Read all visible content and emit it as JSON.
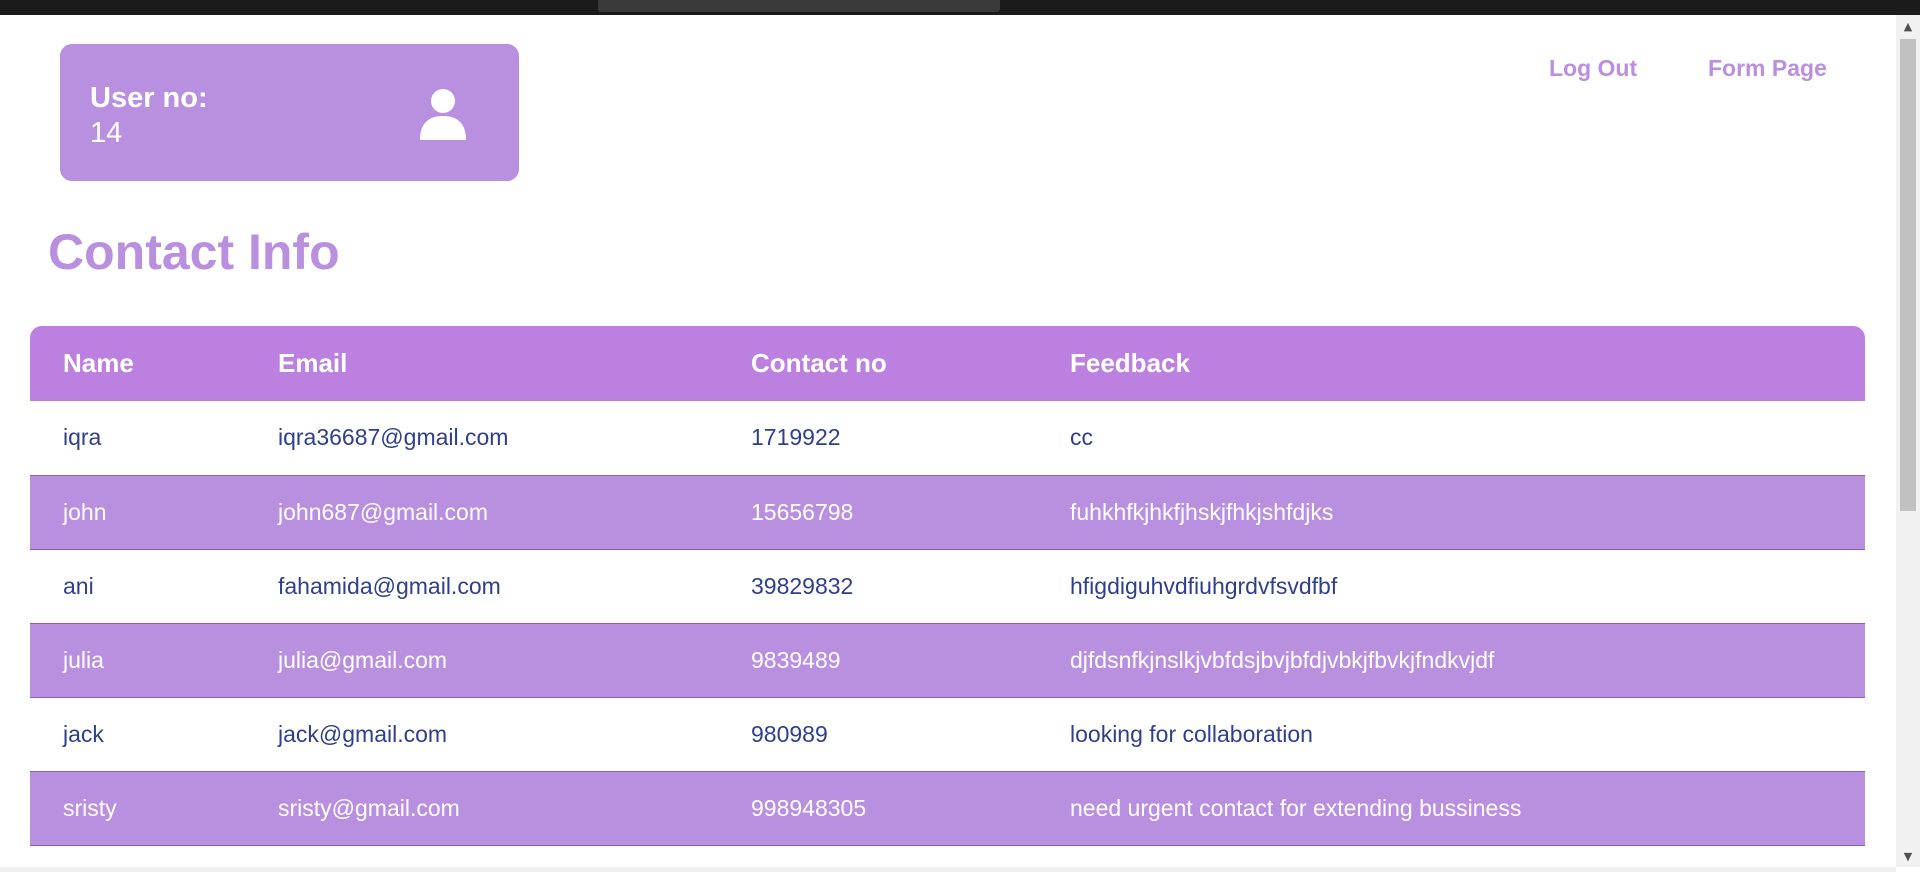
{
  "header": {
    "user_label": "User no:",
    "user_number": "14",
    "user_icon": "user-icon"
  },
  "nav": {
    "logout_label": "Log Out",
    "form_label": "Form Page"
  },
  "page": {
    "title": "Contact Info"
  },
  "table": {
    "columns": [
      "Name",
      "Email",
      "Contact no",
      "Feedback"
    ],
    "rows": [
      {
        "name": "iqra",
        "email": "iqra36687@gmail.com",
        "contact": "1719922",
        "feedback": "cc"
      },
      {
        "name": "john",
        "email": "john687@gmail.com",
        "contact": "15656798",
        "feedback": "fuhkhfkjhkfjhskjfhkjshfdjks"
      },
      {
        "name": "ani",
        "email": "fahamida@gmail.com",
        "contact": "39829832",
        "feedback": "hfigdiguhvdfiuhgrdvfsvdfbf"
      },
      {
        "name": "julia",
        "email": "julia@gmail.com",
        "contact": "9839489",
        "feedback": "djfdsnfkjnslkjvbfdsjbvjbfdjvbkjfbvkjfndkvjdf"
      },
      {
        "name": "jack",
        "email": "jack@gmail.com",
        "contact": "980989",
        "feedback": "looking for collaboration"
      },
      {
        "name": "sristy",
        "email": "sristy@gmail.com",
        "contact": "998948305",
        "feedback": "need urgent contact for extending bussiness"
      }
    ]
  },
  "colors": {
    "accent": "#b98fe0",
    "header_row": "#bc80e0",
    "text_dark": "#2f3f8c",
    "text_light": "#ffffff"
  }
}
